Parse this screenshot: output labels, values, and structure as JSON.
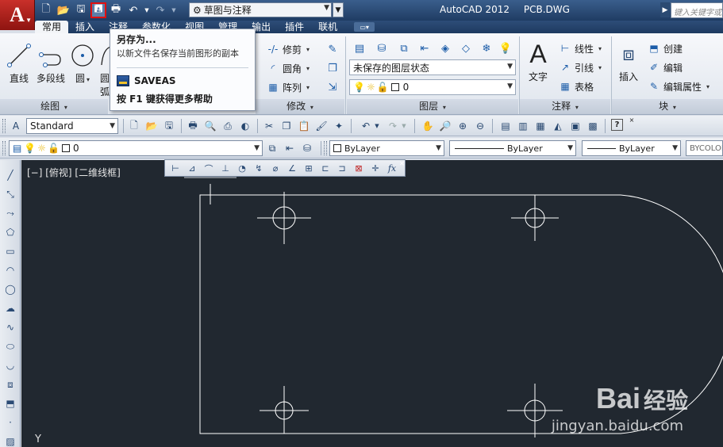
{
  "title_bar": {
    "app_name": "AutoCAD 2012",
    "document": "PCB.DWG",
    "workspace": "草图与注释",
    "search_placeholder": "键入关键字或短语"
  },
  "ribbon_tabs": [
    "常用",
    "插入",
    "注释",
    "参数化",
    "视图",
    "管理",
    "输出",
    "插件",
    "联机"
  ],
  "active_tab": "常用",
  "tooltip": {
    "title": "另存为...",
    "description": "以新文件名保存当前图形的副本",
    "command": "SAVEAS",
    "help": "按 F1 键获得更多帮助"
  },
  "panels": {
    "draw": {
      "title": "绘图",
      "tools": [
        "直线",
        "多段线",
        "圆",
        "圆弧"
      ]
    },
    "modify": {
      "title": "修改",
      "tools": [
        "修剪",
        "圆角",
        "阵列"
      ]
    },
    "layers": {
      "title": "图层",
      "state": "未保存的图层状态",
      "current": "0"
    },
    "annotation": {
      "title": "注释",
      "text_tool": "文字",
      "tools": [
        "线性",
        "引线",
        "表格"
      ]
    },
    "block": {
      "title": "块",
      "insert_tool": "插入",
      "tools": [
        "创建",
        "编辑",
        "编辑属性"
      ]
    }
  },
  "style_toolbar": {
    "text_style": "Standard"
  },
  "layer_toolbar": {
    "layer": "0",
    "color": "ByLayer",
    "linetype": "ByLayer",
    "lineweight": "ByLayer",
    "plot_style": "BYCOLOR"
  },
  "viewport": {
    "label": "[−] [俯视] [二维线框]",
    "ucs_axis": "Y"
  },
  "watermark": {
    "brand": "Bai",
    "brand_cn": "经验",
    "url": "jingyan.baidu.com"
  },
  "colors": {
    "canvas": "#212830",
    "linework": "#ffffff",
    "highlight": "#e01010"
  }
}
